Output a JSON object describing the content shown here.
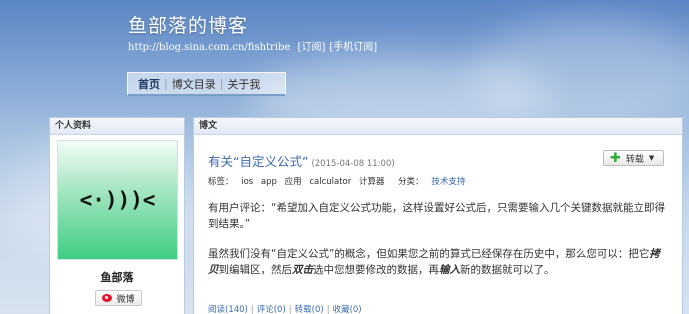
{
  "header": {
    "title": "鱼部落的博客",
    "url": "http://blog.sina.com.cn/fishtribe",
    "subscribe": "[订阅]",
    "mobile_subscribe": "[手机订阅]"
  },
  "nav": {
    "items": [
      "首页",
      "博文目录",
      "关于我"
    ],
    "separator": "|"
  },
  "profile": {
    "heading": "个人资料",
    "avatar_text": "<·)))<",
    "name": "鱼部落",
    "weibo_label": "微博"
  },
  "article": {
    "section_heading": "博文",
    "title": "有关“自定义公式”",
    "date": "(2015-04-08 11:00)",
    "repost_label": "转载",
    "tags_label": "标签：",
    "tags": [
      "ios",
      "app",
      "应用",
      "calculator",
      "计算器"
    ],
    "category_label": "分类：",
    "category": "技术支持",
    "para1": "有用户评论：“希望加入自定义公式功能，这样设置好公式后，只需要输入几个关键数据就能立即得到结果。”",
    "para2_a": "虽然我们没有“自定义公式”的概念，但如果您之前的算式已经保存在历史中，那么您可以：把它",
    "para2_copy": "拷贝",
    "para2_b": "到编辑区，然后",
    "para2_dblclick": "双击",
    "para2_c": "选中您想要修改的数据，再",
    "para2_input": "输入",
    "para2_d": "新的数据就可以了。",
    "stats": {
      "read": "阅读(140)",
      "comment": "评论(0)",
      "repost": "转载(0)",
      "favorite": "收藏(0)"
    }
  },
  "colors": {
    "sky_top": "#5b86c5",
    "link": "#3a6bb0",
    "avatar_green": "#3fcd84",
    "weibo_red": "#e6162d",
    "plus_green": "#2fae3a"
  }
}
